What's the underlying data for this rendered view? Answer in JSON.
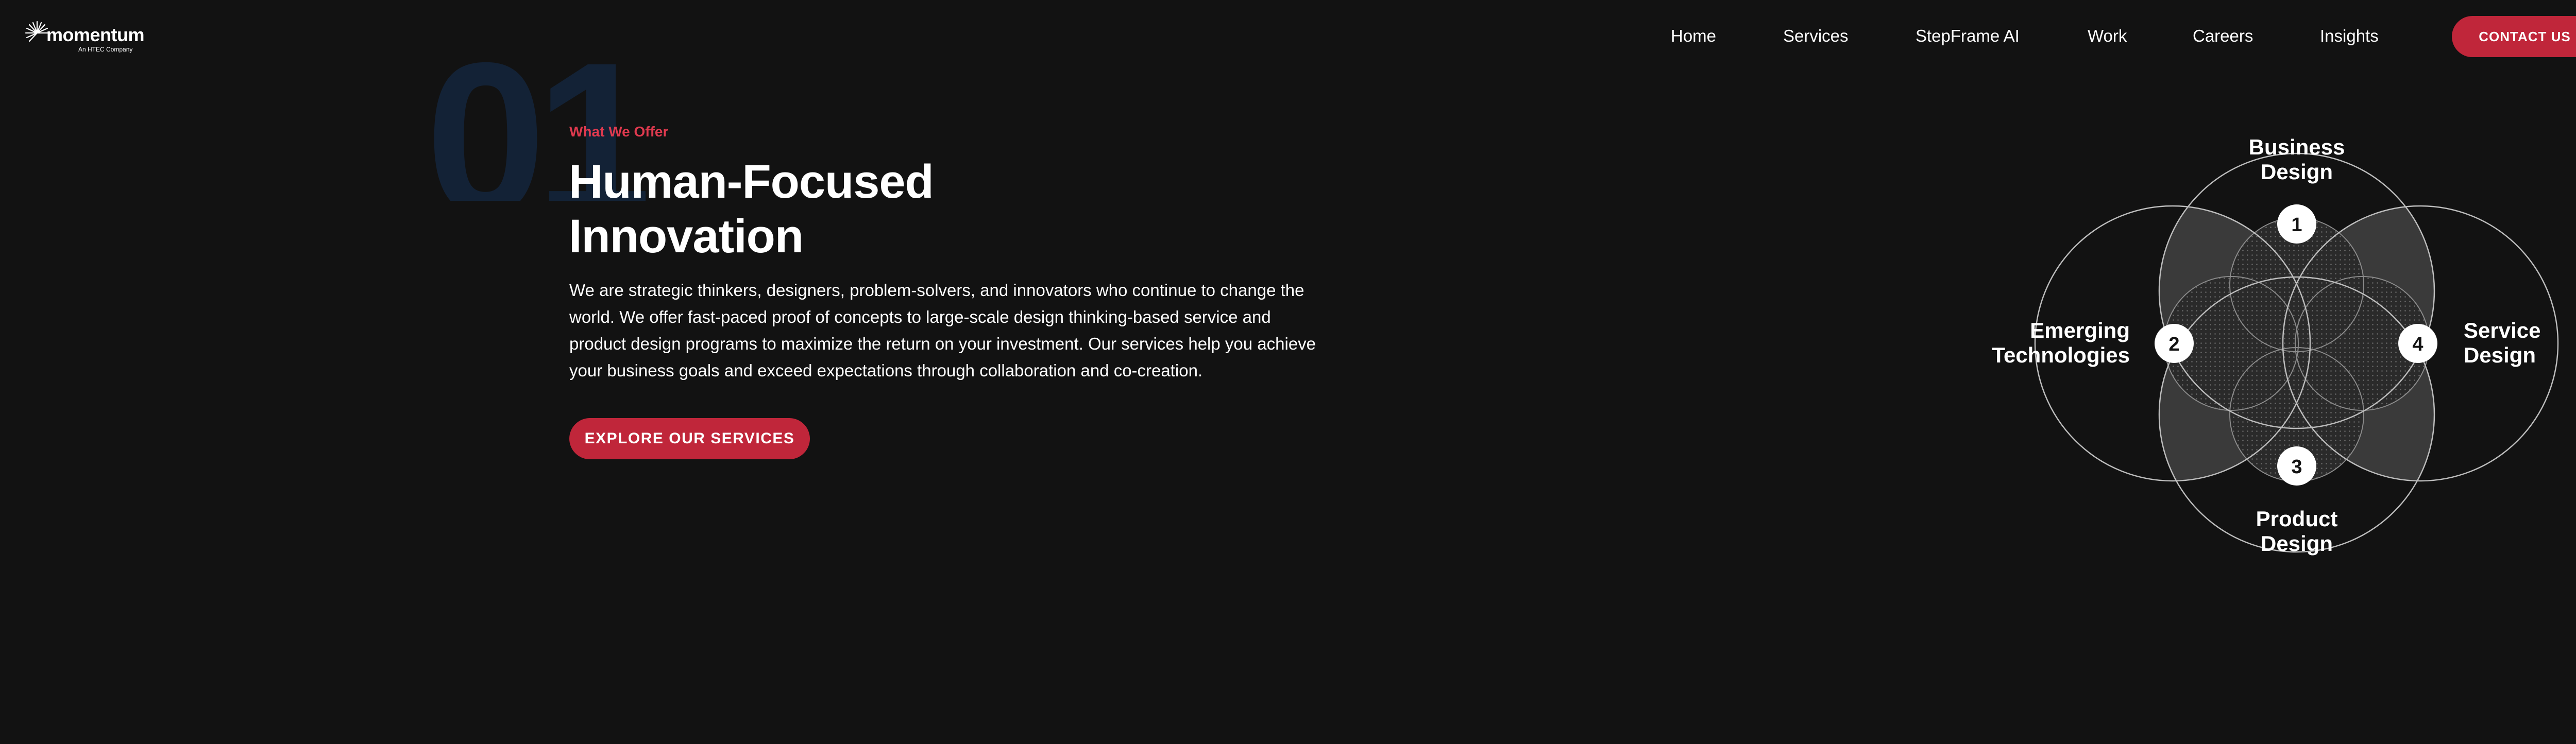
{
  "brand": {
    "name": "momentum",
    "tagline": "An HTEC Company"
  },
  "nav": {
    "items": [
      {
        "id": "home",
        "label": "Home"
      },
      {
        "id": "services",
        "label": "Services"
      },
      {
        "id": "stepframe",
        "label": "StepFrame AI"
      },
      {
        "id": "work",
        "label": "Work"
      },
      {
        "id": "careers",
        "label": "Careers"
      },
      {
        "id": "insights",
        "label": "Insights"
      }
    ],
    "contact_label": "CONTACT US"
  },
  "section": {
    "number": "01",
    "eyebrow": "What We Offer",
    "title_line1": "Human-Focused",
    "title_line2": "Innovation",
    "body": "We are strategic thinkers, designers, problem-solvers, and innovators who continue to change the world. We offer fast-paced proof of concepts to large-scale design thinking-based service and product design programs to maximize the return on your investment. Our services help you achieve your business goals and exceed expectations through collaboration and co-creation.",
    "cta_label": "EXPLORE OUR SERVICES"
  },
  "diagram": {
    "circles": [
      {
        "id": "business",
        "number": "1",
        "label_line1": "Business",
        "label_line2": "Design"
      },
      {
        "id": "emerging",
        "number": "2",
        "label_line1": "Emerging",
        "label_line2": "Technologies"
      },
      {
        "id": "product",
        "number": "3",
        "label_line1": "Product",
        "label_line2": "Design"
      },
      {
        "id": "service",
        "number": "4",
        "label_line1": "Service",
        "label_line2": "Design"
      }
    ]
  },
  "colors": {
    "background": "#121212",
    "accent": "#c0263a",
    "eyebrow": "#e03a4f",
    "big_number": "#132236"
  }
}
